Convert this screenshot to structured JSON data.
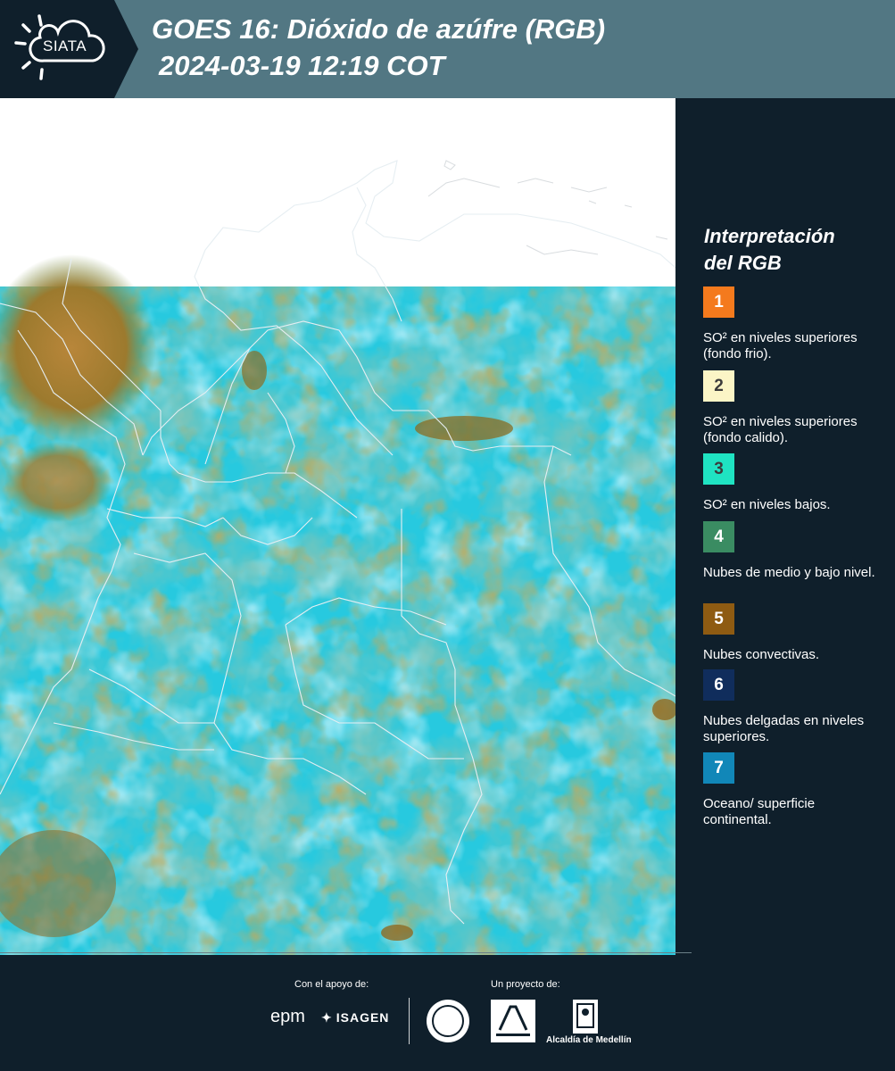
{
  "header": {
    "logo_text": "SIATA",
    "title_line1": "GOES 16: Dióxido de azúfre (RGB)",
    "title_line2": "2024-03-19 12:19 COT"
  },
  "legend": {
    "title_line1": "Interpretación",
    "title_line2": "del RGB",
    "items": [
      {
        "number": "1",
        "color": "#f47a1d",
        "label": "SO² en niveles superiores (fondo frio)."
      },
      {
        "number": "2",
        "color": "#fbf5c6",
        "label": "SO² en niveles superiores (fondo calido)."
      },
      {
        "number": "3",
        "color": "#1fe3c2",
        "label": "SO² en niveles bajos."
      },
      {
        "number": "4",
        "color": "#3a8c62",
        "label": "Nubes de medio y bajo nivel."
      },
      {
        "number": "5",
        "color": "#8e5b12",
        "label": "Nubes convectivas."
      },
      {
        "number": "6",
        "color": "#102d5c",
        "label": "Nubes delgadas en niveles superiores."
      },
      {
        "number": "7",
        "color": "#1187b8",
        "label": "Oceano/ superficie continental."
      }
    ]
  },
  "footer": {
    "support_label": "Con el apoyo de:",
    "project_label": "Un proyecto de:",
    "epm": "epm",
    "isagen": "ISAGEN",
    "alcaldia": "Alcaldía de Medellín"
  }
}
